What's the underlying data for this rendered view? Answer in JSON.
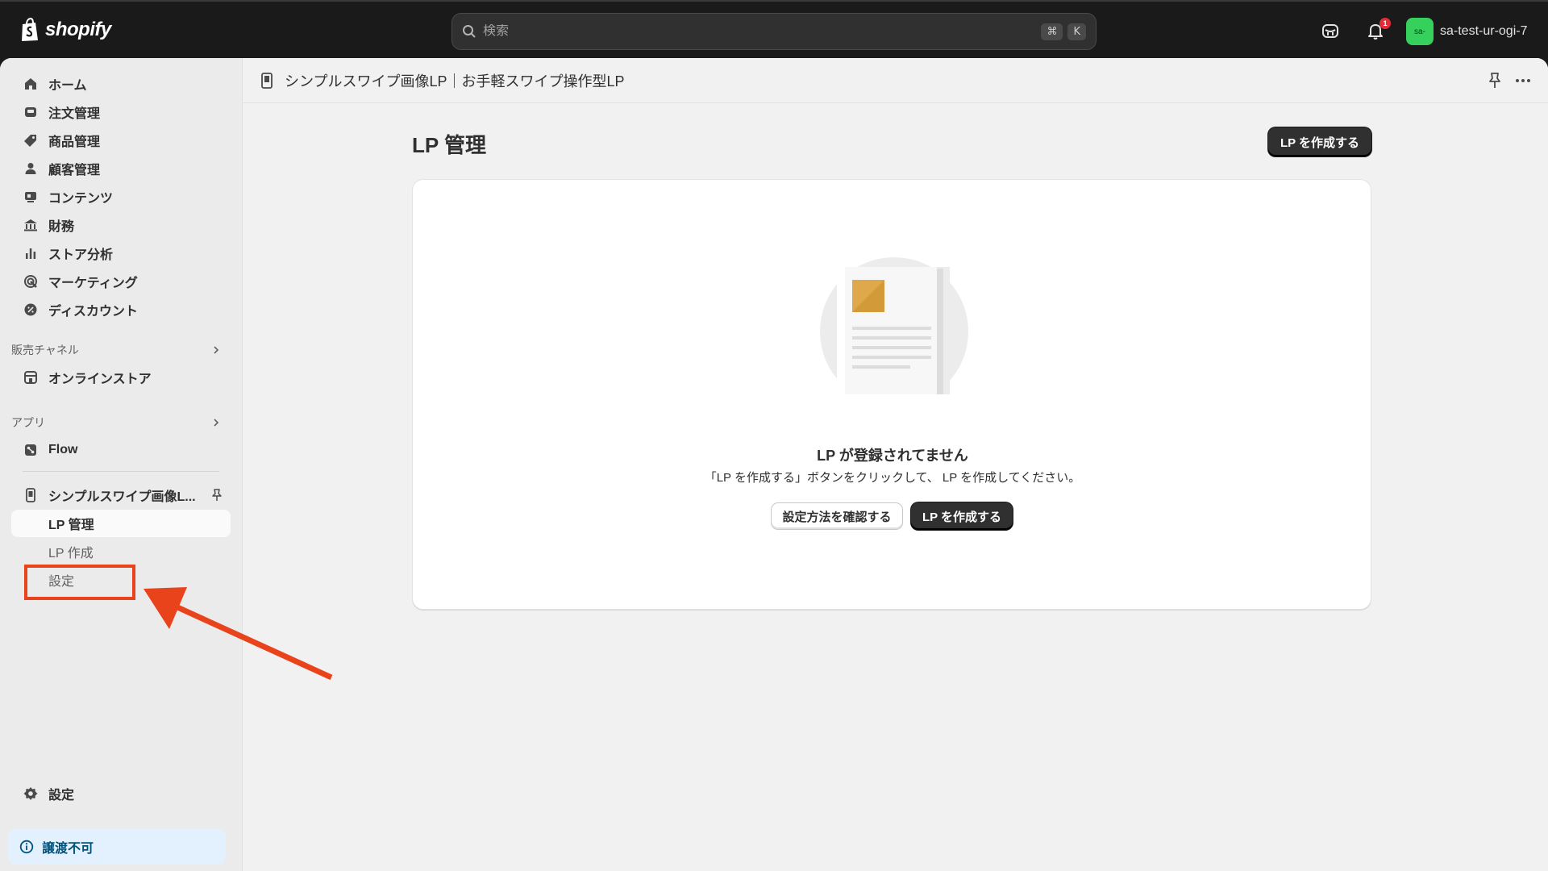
{
  "topbar": {
    "brand": "shopify",
    "search_placeholder": "検索",
    "shortcut_cmd": "⌘",
    "shortcut_key": "K",
    "notification_count": "1",
    "avatar_initials": "sa-",
    "store_name": "sa-test-ur-ogi-7"
  },
  "sidebar": {
    "main_items": [
      {
        "label": "ホーム",
        "icon": "home-icon"
      },
      {
        "label": "注文管理",
        "icon": "inbox-icon"
      },
      {
        "label": "商品管理",
        "icon": "tag-icon"
      },
      {
        "label": "顧客管理",
        "icon": "person-icon"
      },
      {
        "label": "コンテンツ",
        "icon": "content-icon"
      },
      {
        "label": "財務",
        "icon": "bank-icon"
      },
      {
        "label": "ストア分析",
        "icon": "bar-chart-icon"
      },
      {
        "label": "マーケティング",
        "icon": "target-icon"
      },
      {
        "label": "ディスカウント",
        "icon": "discount-icon"
      }
    ],
    "sales_channels_title": "販売チャネル",
    "online_store_label": "オンラインストア",
    "apps_title": "アプリ",
    "flow_label": "Flow",
    "app_name": "シンプルスワイプ画像L...",
    "app_sub_items": [
      "LP 管理",
      "LP 作成",
      "設定"
    ],
    "settings_label": "設定",
    "info_label": "譲渡不可"
  },
  "app_header": {
    "title": "シンプルスワイプ画像LP｜お手軽スワイプ操作型LP"
  },
  "page": {
    "title": "LP 管理",
    "create_button": "LP を作成する",
    "empty_title": "LP が登録されてません",
    "empty_description": "「LP を作成する」ボタンをクリックして、 LP を作成してください。",
    "guide_button": "設定方法を確認する",
    "create_button_2": "LP を作成する"
  },
  "colors": {
    "accent_annotation": "#e9431c",
    "avatar_bg": "#36d05d",
    "primary_button": "#303030"
  }
}
